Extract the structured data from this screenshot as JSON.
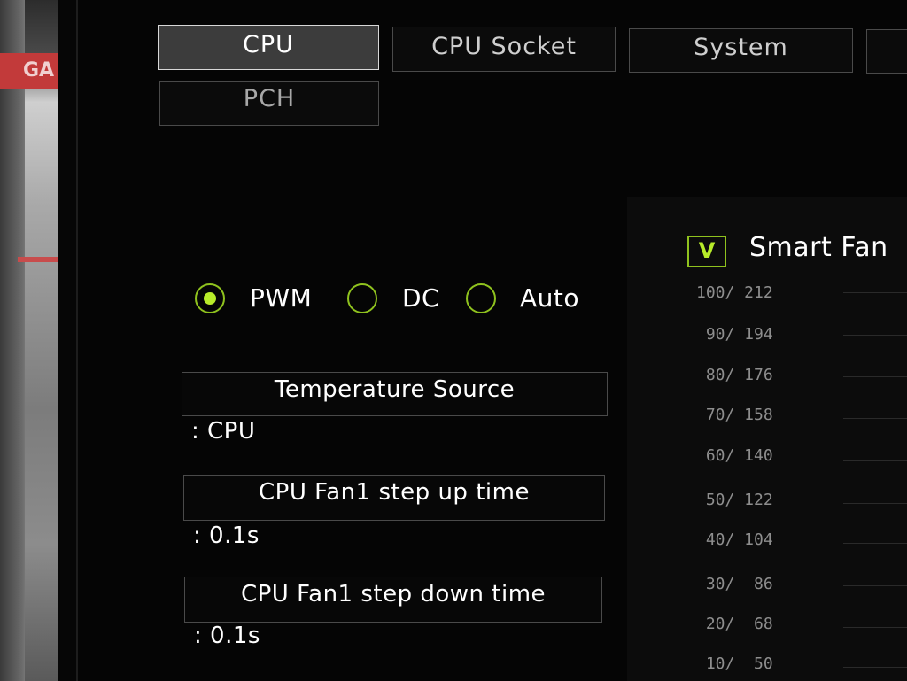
{
  "left_edge": {
    "brand_text": "GA"
  },
  "tabs": [
    {
      "label": "CPU",
      "active": true
    },
    {
      "label": "CPU Socket",
      "active": false
    },
    {
      "label": "System",
      "active": false
    },
    {
      "label": "",
      "active": false
    },
    {
      "label": "PCH",
      "active": false
    }
  ],
  "fan_control_mode": {
    "options": [
      {
        "label": "PWM",
        "selected": true
      },
      {
        "label": "DC",
        "selected": false
      },
      {
        "label": "Auto",
        "selected": false
      }
    ]
  },
  "settings": [
    {
      "label": "Temperature Source",
      "value": ": CPU"
    },
    {
      "label": "CPU Fan1 step up time",
      "value": ": 0.1s"
    },
    {
      "label": "CPU Fan1 step down time",
      "value": ": 0.1s"
    }
  ],
  "smart_fan": {
    "checkbox_mark": "V",
    "checked": true,
    "label": "Smart Fan",
    "y_axis_labels": [
      "100/ 212",
      " 90/ 194",
      " 80/ 176",
      " 70/ 158",
      " 60/ 140",
      " 50/ 122",
      " 40/ 104",
      " 30/  86",
      " 20/  68",
      " 10/  50"
    ]
  },
  "colors": {
    "accent_green": "#b8ec2a",
    "background": "#050505",
    "active_tab_bg": "#3c3c3c",
    "border_gray": "#4a4a4a"
  }
}
